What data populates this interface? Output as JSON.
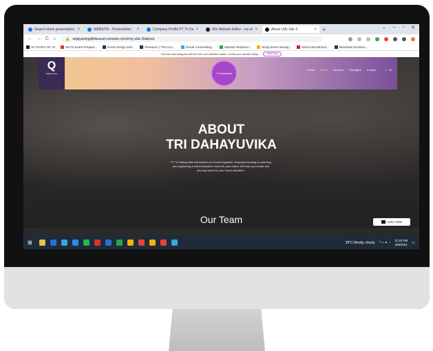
{
  "browser": {
    "tabs": [
      {
        "title": "Search blank presentation - ",
        "active": false
      },
      {
        "title": "WEBSITE - Presentation",
        "active": false
      },
      {
        "title": "Company Profile PT Tri Dahu",
        "active": false
      },
      {
        "title": "Wix Website Editor - my-site",
        "active": false
      },
      {
        "title": "About | My Site 3",
        "active": true
      }
    ],
    "new_tab": "+",
    "window_controls": [
      "⌄",
      "–",
      "▫",
      "✕"
    ],
    "nav": [
      "←",
      "→",
      "C",
      "⌂"
    ],
    "url": "wijayaningdhikusum.wixsite.com/my-site-3/about",
    "bookmarks": [
      "10 YEARS OF 10",
      "IELTS Exam Prepara...",
      "Event Design and...",
      "Research | The Inco...",
      "Virtual Counselling...",
      "Standar Notulensi...",
      "Study Event Manag...",
      "Most international...",
      "Beasiswa Scholars..."
    ],
    "wix_notice": "This site was designed with the WIX.com website builder. Create your website today.",
    "wix_button": "Start Now"
  },
  "site": {
    "logo_letter": "Q",
    "logo_text": "Tagline Here",
    "brand_badge": "Tri Dahayuvika",
    "menu": [
      "Home",
      "About",
      "Services",
      "Packages",
      "Contact"
    ],
    "menu_active": "About",
    "social": [
      "f",
      "◎"
    ],
    "heading_line1": "ABOUT",
    "heading_line2": "TRI DAHAYUVIKA",
    "description": "PT Tri Dahayuvika Indonesia is an Event Organizer company focusing on planning and organizing a brand activation event for your brand. We help you create and develop ideas for your brand activation.",
    "team_heading": "Our Team",
    "chat_label": "Let's Chat!"
  },
  "taskbar": {
    "weather": "29°C  Mostly cloudy",
    "time": "11:22 PM",
    "date": "8/9/2022",
    "app_colors": [
      "#e8c043",
      "#2f6ed1",
      "#3aa7e0",
      "#2f8ae6",
      "#1db954",
      "#d9342b",
      "#2f6ed1",
      "#28a745",
      "#f4b400",
      "#e8453c",
      "#f4b400",
      "#e84135",
      "#3aa7e0"
    ]
  },
  "colors": {
    "header_purple": "#3a2a55",
    "brand_badge": "#a448c8",
    "taskbar": "#1f2b3a"
  }
}
